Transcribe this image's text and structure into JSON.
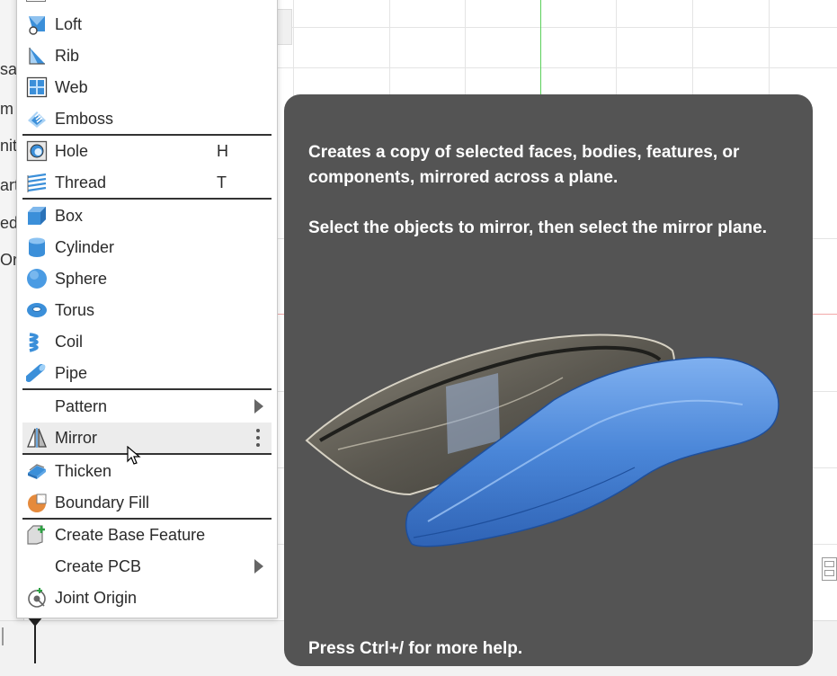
{
  "left_panel": {
    "items": [
      {
        "label": "sa",
        "dark": true
      },
      {
        "label": "m",
        "dark": false
      },
      {
        "label": "nit",
        "dark": false
      },
      {
        "label": "art",
        "dark": false
      },
      {
        "label": "ed",
        "dark": false
      },
      {
        "label": "Or",
        "dark": false
      }
    ]
  },
  "menu": {
    "items": [
      {
        "name": "loft",
        "label": "Loft",
        "icon": "loft-icon"
      },
      {
        "name": "rib",
        "label": "Rib",
        "icon": "rib-icon"
      },
      {
        "name": "web",
        "label": "Web",
        "icon": "web-icon"
      },
      {
        "name": "emboss",
        "label": "Emboss",
        "icon": "emboss-icon"
      },
      {
        "name": "hole",
        "label": "Hole",
        "shortcut": "H",
        "icon": "hole-icon"
      },
      {
        "name": "thread",
        "label": "Thread",
        "shortcut": "T",
        "icon": "thread-icon"
      },
      {
        "name": "box",
        "label": "Box",
        "icon": "box-icon"
      },
      {
        "name": "cylinder",
        "label": "Cylinder",
        "icon": "cylinder-icon"
      },
      {
        "name": "sphere",
        "label": "Sphere",
        "icon": "sphere-icon"
      },
      {
        "name": "torus",
        "label": "Torus",
        "icon": "torus-icon"
      },
      {
        "name": "coil",
        "label": "Coil",
        "icon": "coil-icon"
      },
      {
        "name": "pipe",
        "label": "Pipe",
        "icon": "pipe-icon"
      },
      {
        "name": "pattern",
        "label": "Pattern",
        "submenu": true
      },
      {
        "name": "mirror",
        "label": "Mirror",
        "icon": "mirror-icon",
        "highlighted": true,
        "more_options": true
      },
      {
        "name": "thicken",
        "label": "Thicken",
        "icon": "thicken-icon"
      },
      {
        "name": "boundary-fill",
        "label": "Boundary Fill",
        "icon": "boundary-fill-icon"
      },
      {
        "name": "create-base-feature",
        "label": "Create Base Feature",
        "icon": "create-base-feature-icon"
      },
      {
        "name": "create-pcb",
        "label": "Create PCB",
        "submenu": true
      },
      {
        "name": "joint-origin",
        "label": "Joint Origin",
        "icon": "joint-origin-icon"
      }
    ]
  },
  "tooltip": {
    "description": "Creates a copy of selected faces, bodies, features, or components, mirrored across a plane.",
    "instruction": "Select the objects to mirror, then select the mirror plane.",
    "help": "Press Ctrl+/ for more help.",
    "illustration": "mirrored-body-illustration"
  },
  "colors": {
    "icon_blue": "#3b8fd9",
    "tooltip_bg": "#545454",
    "highlight_bg": "#ececec",
    "mirror_body_blue": "#4a86d8"
  }
}
